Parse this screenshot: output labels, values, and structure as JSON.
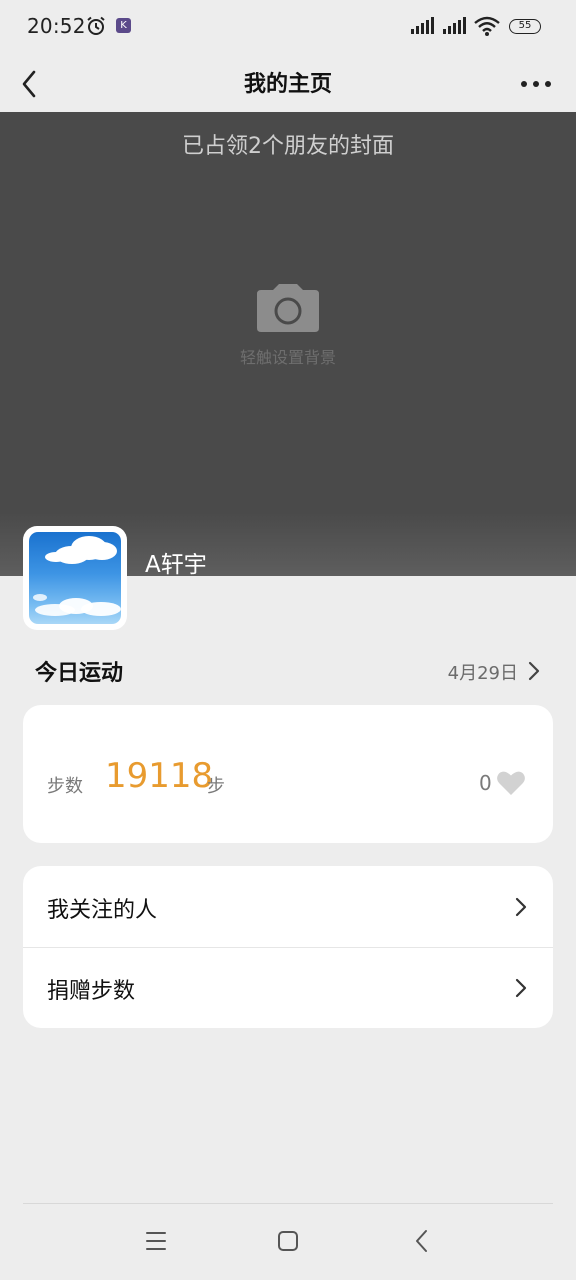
{
  "status_bar": {
    "time": "20:52",
    "app_badge": "K",
    "battery": "55"
  },
  "header": {
    "title": "我的主页",
    "back_icon": "chevron-left-icon",
    "more_icon": "more-horizontal-icon"
  },
  "cover": {
    "title": "已占领2个朋友的封面",
    "hint": "轻触设置背景",
    "camera_icon": "camera-icon"
  },
  "profile": {
    "username": "A轩宇"
  },
  "today": {
    "title": "今日运动",
    "date": "4月29日"
  },
  "steps": {
    "label": "步数",
    "value": "19118",
    "unit": "步",
    "likes": "0"
  },
  "menu": {
    "items": [
      {
        "label": "我关注的人"
      },
      {
        "label": "捐赠步数"
      }
    ]
  },
  "colors": {
    "background": "#ededed",
    "cover": "#4a4a4a",
    "steps_accent": "#e89b2f",
    "card": "#ffffff"
  }
}
